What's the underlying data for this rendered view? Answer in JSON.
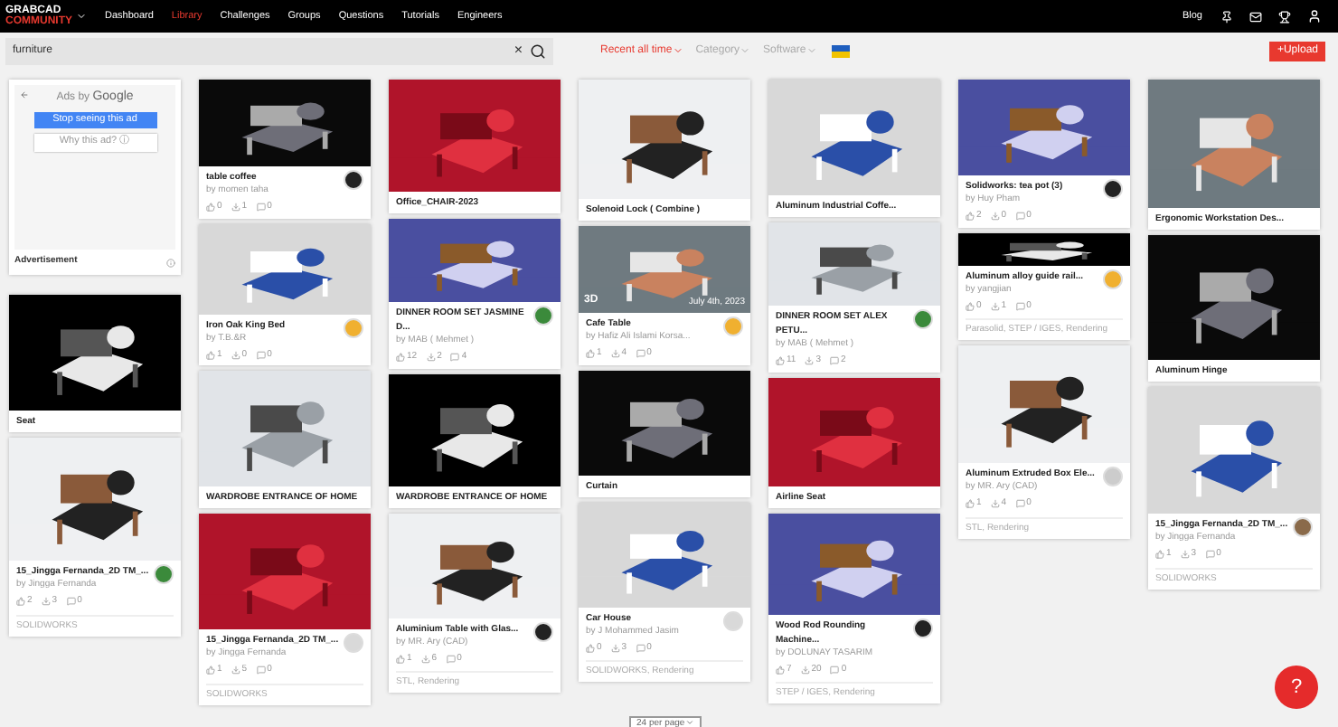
{
  "nav": {
    "logo_top": "GRABCAD",
    "logo_bottom": "COMMUNITY",
    "items": [
      {
        "label": "Dashboard",
        "selected": false
      },
      {
        "label": "Library",
        "selected": true
      },
      {
        "label": "Challenges",
        "selected": false
      },
      {
        "label": "Groups",
        "selected": false
      },
      {
        "label": "Questions",
        "selected": false
      },
      {
        "label": "Tutorials",
        "selected": false
      },
      {
        "label": "Engineers",
        "selected": false
      }
    ],
    "blog": "Blog"
  },
  "search": {
    "value": "furniture",
    "clear": "×"
  },
  "filters": [
    {
      "label": "Recent all time",
      "selected": true
    },
    {
      "label": "Category",
      "selected": false
    },
    {
      "label": "Software",
      "selected": false
    }
  ],
  "upload": "+Upload",
  "ad": {
    "brand": "Ads by",
    "google": "Google",
    "stop": "Stop seeing this ad",
    "why": "Why this ad?",
    "why_icon": "ⓘ",
    "label": "Advertisement"
  },
  "columns": [
    {
      "cards": [
        {
          "title": "Seat"
        },
        {
          "title": "15_Jingga Fernanda_2D TM_...",
          "author": "by Jingga Fernanda",
          "stats": [
            "2",
            "3",
            "0"
          ],
          "tags": "SOLIDWORKS"
        }
      ]
    },
    {
      "cards": [
        {
          "title": "table coffee",
          "author": "by momen taha",
          "stats": [
            "0",
            "1",
            "0"
          ]
        },
        {
          "title": "Iron Oak King Bed",
          "author": "by T.B.&R",
          "stats": [
            "1",
            "0",
            "0"
          ]
        },
        {
          "title": "WARDROBE ENTRANCE OF HOME"
        },
        {
          "title": "15_Jingga Fernanda_2D TM_...",
          "author": "by Jingga Fernanda",
          "stats": [
            "1",
            "5",
            "0"
          ],
          "tags": "SOLIDWORKS"
        }
      ]
    },
    {
      "cards": [
        {
          "title": "Office_CHAIR-2023"
        },
        {
          "title": "DINNER ROOM SET JASMINE D...",
          "author": "by MAB ( Mehmet )",
          "stats": [
            "12",
            "2",
            "4"
          ]
        },
        {
          "title": "WARDROBE ENTRANCE OF HOME"
        },
        {
          "title": "Aluminium Table with Glas...",
          "author": "by MR. Ary (CAD)",
          "stats": [
            "1",
            "6",
            "0"
          ],
          "tags": "STL, Rendering"
        }
      ]
    },
    {
      "cards": [
        {
          "title": "Solenoid Lock ( Combine )"
        },
        {
          "title": "Cafe Table",
          "author": "by Hafiz Ali Islami Korsa...",
          "stats": [
            "1",
            "4",
            "0"
          ],
          "badge": "3D",
          "date": "July 4th, 2023"
        },
        {
          "title": "Curtain"
        },
        {
          "title": "Car House",
          "author": "by J Mohammed Jasim",
          "stats": [
            "0",
            "3",
            "0"
          ],
          "tags": "SOLIDWORKS, Rendering"
        }
      ]
    },
    {
      "cards": [
        {
          "title": "Aluminum Industrial Coffe..."
        },
        {
          "title": "DINNER ROOM SET ALEX PETU...",
          "author": "by MAB ( Mehmet )",
          "stats": [
            "11",
            "3",
            "2"
          ]
        },
        {
          "title": "Airline Seat"
        },
        {
          "title": "Wood Rod Rounding Machine...",
          "author": "by DOLUNAY TASARIM",
          "stats": [
            "7",
            "20",
            "0"
          ],
          "tags": "STEP / IGES, Rendering"
        }
      ]
    },
    {
      "cards": [
        {
          "title": "Solidworks: tea pot (3)",
          "author": "by Huy Pham",
          "stats": [
            "2",
            "0",
            "0"
          ]
        },
        {
          "title": "Aluminum alloy guide rail...",
          "author": "by yangjian",
          "stats": [
            "0",
            "1",
            "0"
          ],
          "tags": "Parasolid, STEP / IGES, Rendering"
        },
        {
          "title": "Aluminum Extruded Box Ele...",
          "author": "by MR. Ary (CAD)",
          "stats": [
            "1",
            "4",
            "0"
          ],
          "tags": "STL, Rendering"
        }
      ]
    },
    {
      "cards": [
        {
          "title": "Ergonomic Workstation Des..."
        },
        {
          "title": "Aluminum Hinge"
        },
        {
          "title": "15_Jingga Fernanda_2D TM_...",
          "author": "by Jingga Fernanda",
          "stats": [
            "1",
            "3",
            "0"
          ],
          "tags": "SOLIDWORKS"
        }
      ]
    }
  ],
  "per_page": "24 per page",
  "help": "?"
}
